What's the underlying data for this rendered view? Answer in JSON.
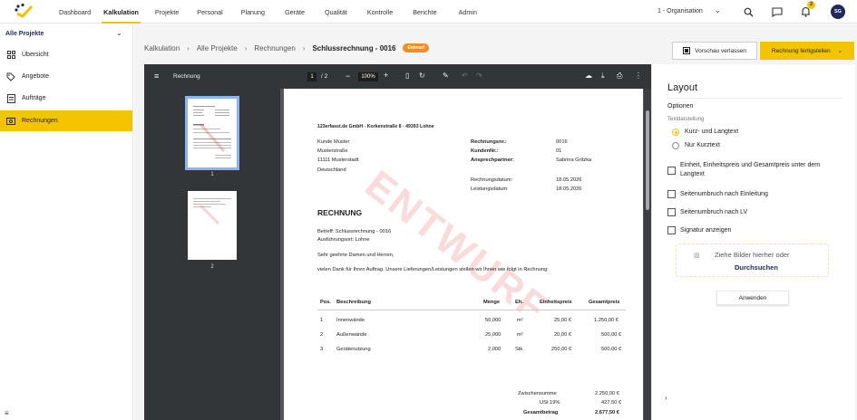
{
  "nav": {
    "items": [
      "Dashboard",
      "Kalkulation",
      "Projekte",
      "Personal",
      "Planung",
      "Geräte",
      "Qualität",
      "Kontrolle",
      "Berichte",
      "Admin"
    ],
    "active": "Kalkulation",
    "org_label": "1 - Organisation",
    "notification_count": "2",
    "avatar_initials": "SG"
  },
  "sidebar": {
    "header": "Alle Projekte",
    "items": [
      {
        "label": "Übersicht",
        "icon": "grid-icon"
      },
      {
        "label": "Angebote",
        "icon": "tag-icon"
      },
      {
        "label": "Aufträge",
        "icon": "list-icon"
      },
      {
        "label": "Rechnungen",
        "icon": "invoice-icon"
      }
    ]
  },
  "breadcrumb": {
    "items": [
      "Kalkulation",
      "Alle Projekte",
      "Rechnungen"
    ],
    "current": "Schlussrechnung - 0016",
    "badge": "Entwurf"
  },
  "actions": {
    "preview_label": "Vorschau verlassen",
    "finish_label": "Rechnung fertigstellen"
  },
  "viewer": {
    "title": "Rechnung",
    "page_current": "1",
    "page_total": "/ 2",
    "zoom": "100%",
    "thumbs": [
      "1",
      "2"
    ]
  },
  "document": {
    "sender": "123erfasst.de GmbH - Korkenstraße 8 - 49393 Lohne",
    "address": [
      "Kunde Muster",
      "Musterstraße",
      "11111 Musterstadt",
      "Deutschland"
    ],
    "meta": [
      {
        "k": "Rechnungsnr.:",
        "v": "0016"
      },
      {
        "k": "KundenNr.:",
        "v": "01"
      },
      {
        "k": "Ansprechpartner:",
        "v": "Sabrina Gritzka"
      }
    ],
    "dates": [
      {
        "k": "Rechnungsdatum:",
        "v": "18.05.2026"
      },
      {
        "k": "Leistungsdatum:",
        "v": "18.05.2026"
      }
    ],
    "heading": "RECHNUNG",
    "betreff": "Betreff: Schlussrechnung - 0016",
    "ort": "Ausführungsort: Lohne",
    "greeting": "Sehr geehrte Damen und Herren,",
    "intro": "vielen Dank für Ihren Auftrag. Unsere Lieferungen/Leistungen stellen wir Ihnen wie folgt in Rechnung:",
    "watermark": "ENTWURF",
    "table_headers": [
      "Pos.",
      "Beschreibung",
      "Menge",
      "Eh.",
      "Einheitspreis",
      "Gesamtpreis"
    ],
    "rows": [
      [
        "1",
        "Innenwände",
        "50,000",
        "m²",
        "25,00 €",
        "1.250,00 €"
      ],
      [
        "2",
        "Außenwände",
        "25,000",
        "m²",
        "20,00 €",
        "500,00 €"
      ],
      [
        "3",
        "Gerätenutzung",
        "2,000",
        "Stk.",
        "250,00 €",
        "500,00 €"
      ]
    ],
    "totals": [
      {
        "k": "Zwischensumme",
        "v": "2.250,00 €"
      },
      {
        "k": "USt 19%",
        "v": "427,50 €"
      },
      {
        "k": "Gesamtbetrag",
        "v": "2.677,50 €"
      }
    ]
  },
  "panel": {
    "title": "Layout",
    "options_label": "Optionen",
    "text_label": "Textdarstellung",
    "radios": [
      "Kurz- und Langtext",
      "Nur Kurztext"
    ],
    "checkboxes": [
      "Einheit, Einheitspreis und Gesamtpreis unter dem Langtext",
      "Seitenumbruch nach Einleitung",
      "Seitenumbruch nach LV",
      "Signatur anzeigen"
    ],
    "drop_text": "Ziehe Bilder hierher oder",
    "drop_link": "Durchsuchen",
    "apply_label": "Anwenden"
  },
  "colors": {
    "accent": "#f5c400",
    "navy": "#1e2a5a",
    "badge": "#f28c28"
  }
}
